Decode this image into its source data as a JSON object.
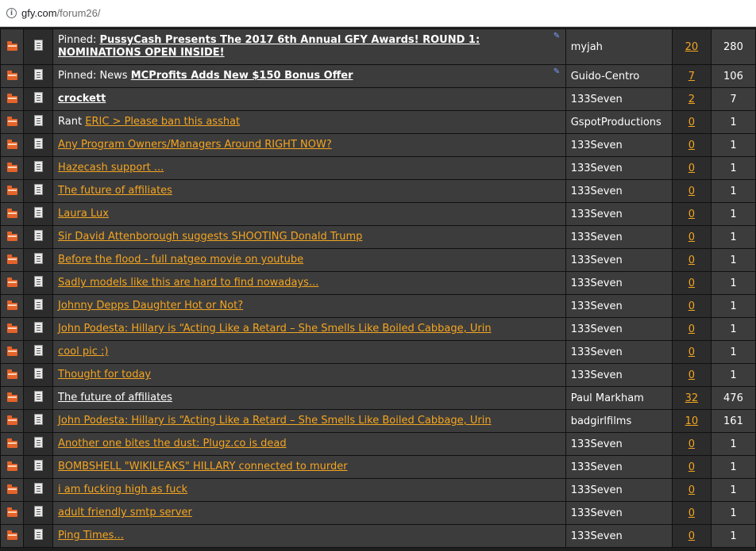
{
  "browser": {
    "url_host": "gfy.com",
    "url_path": "/forum26/"
  },
  "threads": [
    {
      "prefix": "Pinned:",
      "title": "PussyCash Presents The 2017 6th Annual GFY Awards! ROUND 1: NOMINATIONS OPEN INSIDE!",
      "style": "white",
      "author": "myjah",
      "replies": "20",
      "views": "280",
      "pinned": true,
      "tall": true
    },
    {
      "prefix": "Pinned: News",
      "title": "MCProfits Adds New $150 Bonus Offer",
      "style": "white",
      "author": "Guido-Centro",
      "replies": "7",
      "views": "106",
      "pinned": true
    },
    {
      "prefix": "",
      "title": "crockett",
      "style": "white",
      "author": "133Seven",
      "replies": "2",
      "views": "7"
    },
    {
      "prefix": "Rant",
      "title": "ERIC > Please ban this asshat",
      "style": "orange",
      "author": "GspotProductions",
      "replies": "0",
      "views": "1"
    },
    {
      "prefix": "",
      "title": "Any Program Owners/Managers Around RIGHT NOW?",
      "style": "orange",
      "author": "133Seven",
      "replies": "0",
      "views": "1"
    },
    {
      "prefix": "",
      "title": "Hazecash support ...",
      "style": "orange",
      "author": "133Seven",
      "replies": "0",
      "views": "1"
    },
    {
      "prefix": "",
      "title": "The future of affiliates",
      "style": "orange",
      "author": "133Seven",
      "replies": "0",
      "views": "1"
    },
    {
      "prefix": "",
      "title": "Laura Lux",
      "style": "orange",
      "author": "133Seven",
      "replies": "0",
      "views": "1"
    },
    {
      "prefix": "",
      "title": "Sir David Attenborough suggests SHOOTING Donald Trump",
      "style": "orange",
      "author": "133Seven",
      "replies": "0",
      "views": "1"
    },
    {
      "prefix": "",
      "title": "Before the flood - full natgeo movie on youtube",
      "style": "orange",
      "author": "133Seven",
      "replies": "0",
      "views": "1"
    },
    {
      "prefix": "",
      "title": "Sadly models like this are hard to find nowadays...",
      "style": "orange",
      "author": "133Seven",
      "replies": "0",
      "views": "1"
    },
    {
      "prefix": "",
      "title": "Johnny Depps Daughter Hot or Not?",
      "style": "orange",
      "author": "133Seven",
      "replies": "0",
      "views": "1"
    },
    {
      "prefix": "",
      "title": "John Podesta: Hillary is “Acting Like a Retard – She Smells Like Boiled Cabbage, Urin",
      "style": "orange",
      "author": "133Seven",
      "replies": "0",
      "views": "1"
    },
    {
      "prefix": "",
      "title": "cool pic :)",
      "style": "orange",
      "author": "133Seven",
      "replies": "0",
      "views": "1"
    },
    {
      "prefix": "",
      "title": "Thought for today",
      "style": "orange",
      "author": "133Seven",
      "replies": "0",
      "views": "1"
    },
    {
      "prefix": "",
      "title": "The future of affiliates",
      "style": "white-plain",
      "author": "Paul Markham",
      "replies": "32",
      "views": "476"
    },
    {
      "prefix": "",
      "title": "John Podesta: Hillary is “Acting Like a Retard – She Smells Like Boiled Cabbage, Urin",
      "style": "orange",
      "author": "badgirlfilms",
      "replies": "10",
      "views": "161"
    },
    {
      "prefix": "",
      "title": "Another one bites the dust: Plugz.co is dead",
      "style": "orange",
      "author": "133Seven",
      "replies": "0",
      "views": "1"
    },
    {
      "prefix": "",
      "title": "BOMBSHELL \"WIKILEAKS\" HILLARY connected to murder",
      "style": "orange",
      "author": "133Seven",
      "replies": "0",
      "views": "1"
    },
    {
      "prefix": "",
      "title": "i am fucking high as fuck",
      "style": "orange",
      "author": "133Seven",
      "replies": "0",
      "views": "1"
    },
    {
      "prefix": "",
      "title": "adult friendly smtp server",
      "style": "orange",
      "author": "133Seven",
      "replies": "0",
      "views": "1"
    },
    {
      "prefix": "",
      "title": "Ping Times...",
      "style": "orange",
      "author": "133Seven",
      "replies": "0",
      "views": "1"
    }
  ],
  "colors": {
    "link_orange": "#f4a521",
    "folder_orange": "#e4632a",
    "row_bg": "#3c3c3c"
  }
}
